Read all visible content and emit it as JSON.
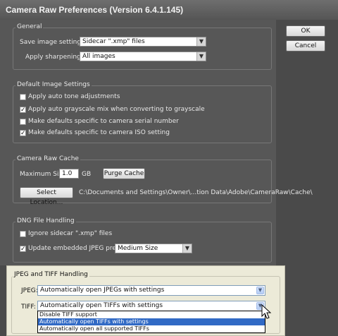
{
  "window": {
    "title": "Camera Raw Preferences  (Version 6.4.1.145)"
  },
  "buttons": {
    "ok": "OK",
    "cancel": "Cancel"
  },
  "general": {
    "legend": "General",
    "save_label": "Save image settings in:",
    "save_value": "Sidecar \".xmp\" files",
    "sharpen_label": "Apply sharpening to:",
    "sharpen_value": "All images"
  },
  "default_image": {
    "legend": "Default Image Settings",
    "options": [
      {
        "label": "Apply auto tone adjustments",
        "checked": false
      },
      {
        "label": "Apply auto grayscale mix when converting to grayscale",
        "checked": true
      },
      {
        "label": "Make defaults specific to camera serial number",
        "checked": false
      },
      {
        "label": "Make defaults specific to camera ISO setting",
        "checked": true
      }
    ]
  },
  "cache": {
    "legend": "Camera Raw Cache",
    "max_size_label": "Maximum Size:",
    "max_size_value": "1.0",
    "unit": "GB",
    "purge_button": "Purge Cache",
    "select_location_button": "Select Location...",
    "path": "C:\\Documents and Settings\\Owner\\...tion Data\\Adobe\\CameraRaw\\Cache\\"
  },
  "dng": {
    "legend": "DNG File Handling",
    "ignore_label": "Ignore sidecar \".xmp\" files",
    "ignore_checked": false,
    "update_label": "Update embedded JPEG previews:",
    "update_checked": true,
    "preview_value": "Medium Size"
  },
  "jpeg_tiff": {
    "legend": "JPEG and TIFF Handling",
    "jpeg_label": "JPEG:",
    "jpeg_value": "Automatically open JPEGs with settings",
    "tiff_label": "TIFF:",
    "tiff_value": "Automatically open TIFFs with settings",
    "tiff_options": [
      "Disable TIFF support",
      "Automatically open TIFFs with settings",
      "Automatically open all supported TIFFs"
    ],
    "tiff_selected_index": 1
  },
  "colors": {
    "selection": "#316ac5"
  }
}
